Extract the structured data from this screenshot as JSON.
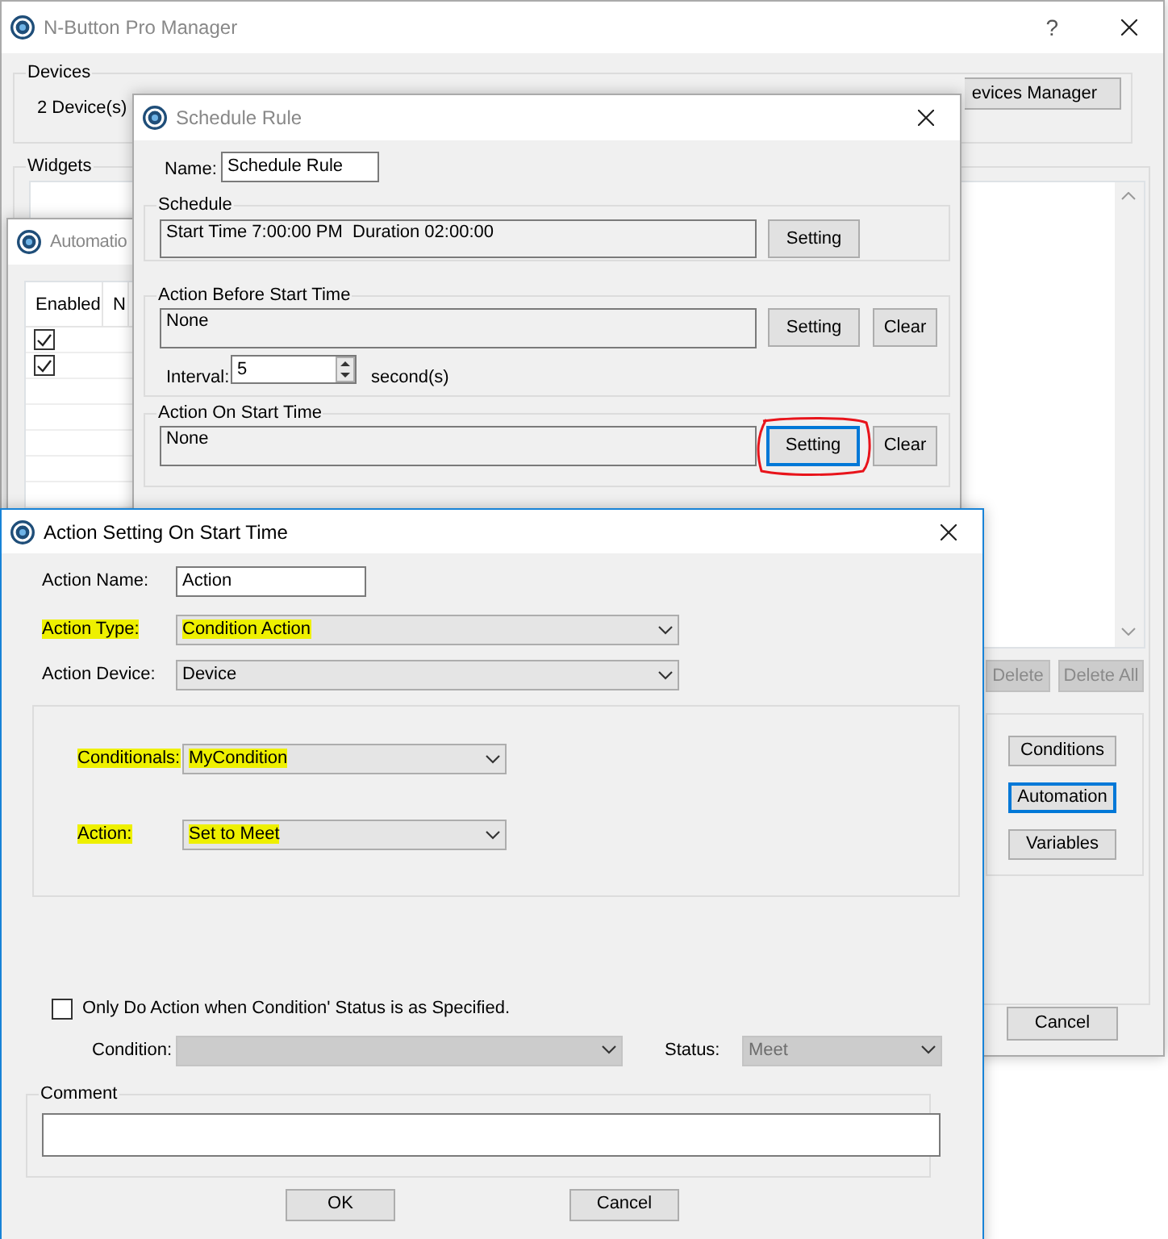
{
  "main_window": {
    "title": "N-Button Pro Manager",
    "help_button": "?",
    "devices": {
      "label": "Devices",
      "count": "2 Device(s)",
      "manager_button": "evices Manager"
    },
    "widgets": {
      "label": "Widgets",
      "delete_button": {
        "label": "Delete",
        "disabled": true
      },
      "delete_all_button": {
        "label": "Delete All",
        "disabled": true
      }
    },
    "side_buttons": [
      {
        "label": "Conditions",
        "focused": false
      },
      {
        "label": "Automation",
        "focused": true
      },
      {
        "label": "Variables",
        "focused": false
      }
    ],
    "cancel_button": "Cancel"
  },
  "automation_window": {
    "title": "Automatio",
    "columns": [
      "Enabled",
      "N"
    ],
    "rows": [
      {
        "enabled": true
      },
      {
        "enabled": true
      }
    ]
  },
  "schedule_window": {
    "title": "Schedule Rule",
    "name_label": "Name:",
    "name_value": "Schedule Rule",
    "schedule": {
      "label": "Schedule",
      "value": "Start Time 7:00:00 PM  Duration 02:00:00",
      "setting_button": "Setting"
    },
    "before_start": {
      "label": "Action Before Start Time",
      "value": "None",
      "setting_button": "Setting",
      "clear_button": "Clear",
      "interval_label": "Interval:",
      "interval_value": "5",
      "interval_unit": "second(s)"
    },
    "on_start": {
      "label": "Action On Start Time",
      "value": "None",
      "setting_button": {
        "label": "Setting",
        "focused": true,
        "circled": true
      },
      "clear_button": "Clear"
    }
  },
  "action_window": {
    "title": "Action Setting On Start Time",
    "fields": [
      {
        "label": "Action Name:",
        "kind": "text",
        "value": "Action",
        "highlighted": false
      },
      {
        "label": "Action Type:",
        "kind": "select",
        "value": "Condition Action",
        "highlighted": true
      },
      {
        "label": "Action Device:",
        "kind": "select",
        "value": "Device",
        "highlighted": false
      }
    ],
    "inner_fields": [
      {
        "label": "Conditionals:",
        "value": "MyCondition",
        "highlighted": true
      },
      {
        "label": "Action:",
        "value": "Set to Meet",
        "highlighted": true
      }
    ],
    "only_do": {
      "label": "Only Do Action when Condition' Status is as Specified.",
      "checked": false
    },
    "condition": {
      "label": "Condition:",
      "disabled": true
    },
    "status": {
      "label": "Status:",
      "value": "Meet",
      "disabled": true
    },
    "comment_label": "Comment",
    "buttons": [
      "OK",
      "Cancel"
    ]
  }
}
